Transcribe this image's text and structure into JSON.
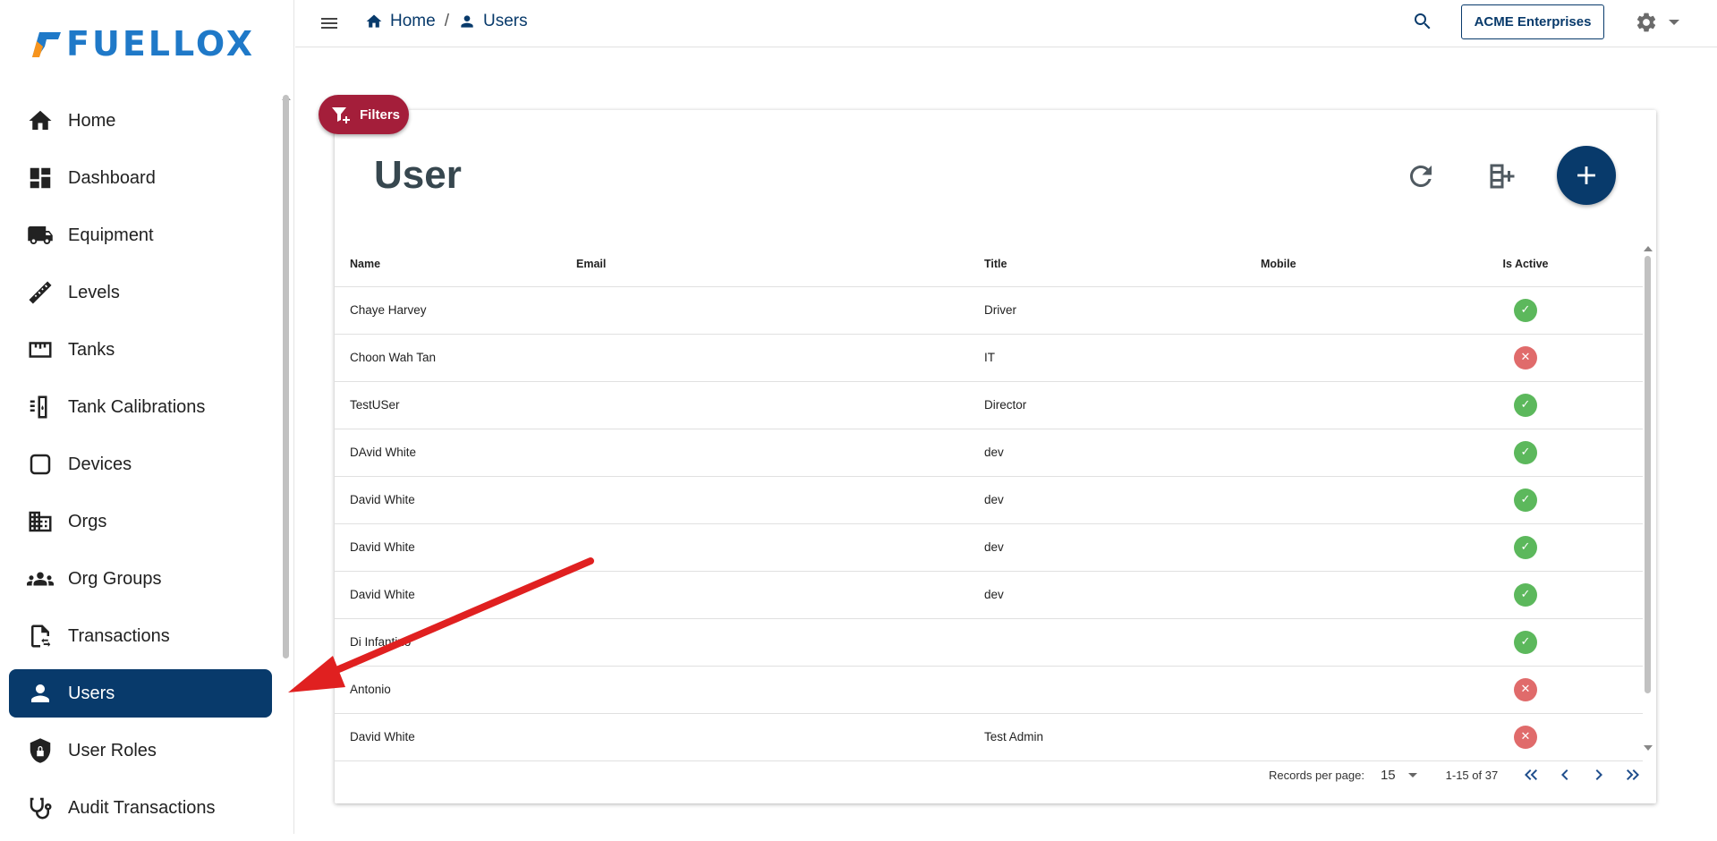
{
  "brand": {
    "name": "FUELLOX",
    "colors": {
      "primary": "#083a6b",
      "logo": "#1f79c8",
      "accent": "#a41e3a",
      "ok": "#5cb85c",
      "error": "#e06b6b",
      "annotation": "#e02020"
    }
  },
  "sidebar": {
    "items": [
      {
        "label": "Home",
        "icon": "home-icon"
      },
      {
        "label": "Dashboard",
        "icon": "dashboard-icon"
      },
      {
        "label": "Equipment",
        "icon": "truck-icon"
      },
      {
        "label": "Levels",
        "icon": "ruler-icon"
      },
      {
        "label": "Tanks",
        "icon": "tank-icon"
      },
      {
        "label": "Tank Calibrations",
        "icon": "calibration-icon"
      },
      {
        "label": "Devices",
        "icon": "device-icon"
      },
      {
        "label": "Orgs",
        "icon": "building-icon"
      },
      {
        "label": "Org Groups",
        "icon": "group-icon"
      },
      {
        "label": "Transactions",
        "icon": "transaction-file-icon"
      },
      {
        "label": "Users",
        "icon": "person-icon",
        "active": true
      },
      {
        "label": "User Roles",
        "icon": "shield-lock-icon"
      },
      {
        "label": "Audit Transactions",
        "icon": "stethoscope-icon"
      }
    ]
  },
  "header": {
    "breadcrumb": [
      {
        "label": "Home",
        "icon": "home-icon"
      },
      {
        "label": "Users",
        "icon": "person-icon"
      }
    ],
    "separator": "/",
    "org_button": "ACME Enterprises"
  },
  "filters": {
    "label": "Filters"
  },
  "main": {
    "title": "User",
    "columns": [
      "Name",
      "Email",
      "Title",
      "Mobile",
      "Is Active"
    ],
    "rows": [
      {
        "name": "Chaye Harvey",
        "email": "",
        "title": "Driver",
        "mobile": "",
        "active": true
      },
      {
        "name": "Choon Wah Tan",
        "email": "",
        "title": "IT",
        "mobile": "",
        "active": false
      },
      {
        "name": "TestUSer",
        "email": "",
        "title": "Director",
        "mobile": "",
        "active": true
      },
      {
        "name": "DAvid White",
        "email": "",
        "title": "dev",
        "mobile": "",
        "active": true
      },
      {
        "name": "David White",
        "email": "",
        "title": "dev",
        "mobile": "",
        "active": true
      },
      {
        "name": "David White",
        "email": "",
        "title": "dev",
        "mobile": "",
        "active": true
      },
      {
        "name": "David White",
        "email": "",
        "title": "dev",
        "mobile": "",
        "active": true
      },
      {
        "name": "Di Infantino",
        "email": "",
        "title": "",
        "mobile": "",
        "active": true
      },
      {
        "name": "Antonio",
        "email": "",
        "title": "",
        "mobile": "",
        "active": false
      },
      {
        "name": "David White",
        "email": "",
        "title": "Test Admin",
        "mobile": "",
        "active": false
      }
    ],
    "pagination": {
      "records_label": "Records per page:",
      "per_page": "15",
      "range": "1-15 of 37"
    }
  }
}
